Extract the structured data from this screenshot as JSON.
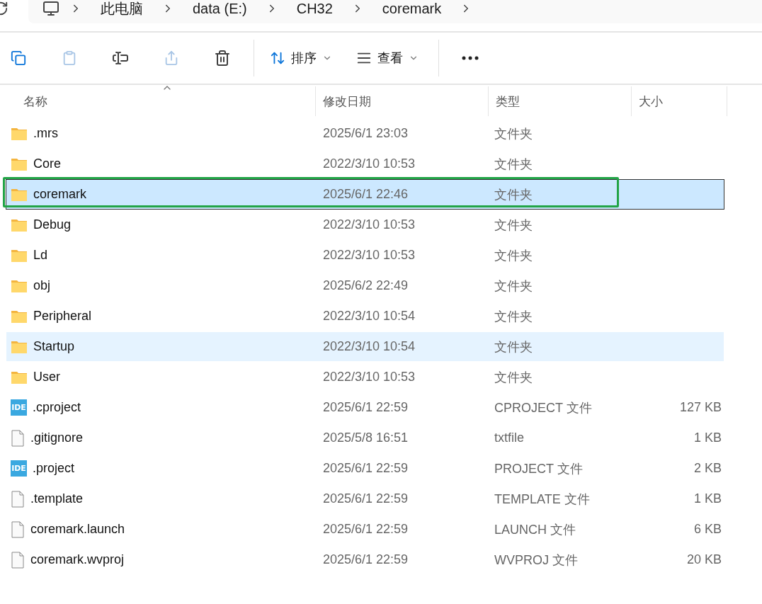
{
  "breadcrumb": [
    "此电脑",
    "data (E:)",
    "CH32",
    "coremark"
  ],
  "toolbar": [
    {
      "kind": "copy",
      "disabled": false
    },
    {
      "kind": "paste",
      "disabled": true
    },
    {
      "kind": "rename",
      "disabled": false
    },
    {
      "kind": "share",
      "disabled": true
    },
    {
      "kind": "delete",
      "disabled": false
    },
    {
      "kind": "sort",
      "label": "排序"
    },
    {
      "kind": "view",
      "label": "查看"
    },
    {
      "kind": "more"
    }
  ],
  "columns": [
    "名称",
    "修改日期",
    "类型",
    "大小"
  ],
  "rows": [
    {
      "kind": "folder",
      "name": ".mrs",
      "date": "2025/6/1 23:03",
      "type": "文件夹",
      "selected": false,
      "hovered": false,
      "highlighted": false
    },
    {
      "kind": "folder",
      "name": "Core",
      "date": "2022/3/10 10:53",
      "type": "文件夹",
      "selected": false,
      "hovered": false,
      "highlighted": false
    },
    {
      "kind": "folder",
      "name": "coremark",
      "date": "2025/6/1 22:46",
      "type": "文件夹",
      "selected": true,
      "hovered": false,
      "highlighted": true
    },
    {
      "kind": "folder",
      "name": "Debug",
      "date": "2022/3/10 10:53",
      "type": "文件夹",
      "selected": false,
      "hovered": false,
      "highlighted": false
    },
    {
      "kind": "folder",
      "name": "Ld",
      "date": "2022/3/10 10:53",
      "type": "文件夹",
      "selected": false,
      "hovered": false,
      "highlighted": false
    },
    {
      "kind": "folder",
      "name": "obj",
      "date": "2025/6/2 22:49",
      "type": "文件夹",
      "selected": false,
      "hovered": false,
      "highlighted": false
    },
    {
      "kind": "folder",
      "name": "Peripheral",
      "date": "2022/3/10 10:54",
      "type": "文件夹",
      "selected": false,
      "hovered": false,
      "highlighted": false
    },
    {
      "kind": "folder",
      "name": "Startup",
      "date": "2022/3/10 10:54",
      "type": "文件夹",
      "selected": false,
      "hovered": true,
      "highlighted": false
    },
    {
      "kind": "folder",
      "name": "User",
      "date": "2022/3/10 10:53",
      "type": "文件夹",
      "selected": false,
      "hovered": false,
      "highlighted": false
    },
    {
      "kind": "ide",
      "icon_text": "IDE",
      "name": ".cproject",
      "date": "2025/6/1 22:59",
      "type": "CPROJECT 文件",
      "size": "127 KB",
      "selected": false,
      "hovered": false,
      "highlighted": false
    },
    {
      "kind": "file",
      "name": ".gitignore",
      "date": "2025/5/8 16:51",
      "type": "txtfile",
      "size": "1 KB",
      "selected": false,
      "hovered": false,
      "highlighted": false
    },
    {
      "kind": "ide",
      "icon_text": "IDE",
      "name": ".project",
      "date": "2025/6/1 22:59",
      "type": "PROJECT 文件",
      "size": "2 KB",
      "selected": false,
      "hovered": false,
      "highlighted": false
    },
    {
      "kind": "file",
      "name": ".template",
      "date": "2025/6/1 22:59",
      "type": "TEMPLATE 文件",
      "size": "1 KB",
      "selected": false,
      "hovered": false,
      "highlighted": false
    },
    {
      "kind": "file",
      "name": "coremark.launch",
      "date": "2025/6/1 22:59",
      "type": "LAUNCH 文件",
      "size": "6 KB",
      "selected": false,
      "hovered": false,
      "highlighted": false
    },
    {
      "kind": "file",
      "name": "coremark.wvproj",
      "date": "2025/6/1 22:59",
      "type": "WVPROJ 文件",
      "size": "20 KB",
      "selected": false,
      "hovered": false,
      "highlighted": false
    }
  ]
}
